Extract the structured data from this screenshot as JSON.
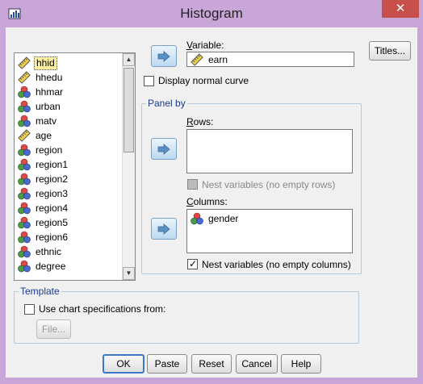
{
  "window": {
    "title": "Histogram",
    "close_glyph": "✕"
  },
  "variables": [
    {
      "name": "hhid",
      "icon": "ruler-scale-icon",
      "selected": true
    },
    {
      "name": "hhedu",
      "icon": "ruler-scale-icon"
    },
    {
      "name": "hhmar",
      "icon": "nominal-icon"
    },
    {
      "name": "urban",
      "icon": "nominal-icon"
    },
    {
      "name": "matv",
      "icon": "nominal-icon"
    },
    {
      "name": "age",
      "icon": "ruler-scale-icon"
    },
    {
      "name": "region",
      "icon": "nominal-icon"
    },
    {
      "name": "region1",
      "icon": "nominal-icon"
    },
    {
      "name": "region2",
      "icon": "nominal-icon"
    },
    {
      "name": "region3",
      "icon": "nominal-icon"
    },
    {
      "name": "region4",
      "icon": "nominal-icon"
    },
    {
      "name": "region5",
      "icon": "nominal-icon"
    },
    {
      "name": "region6",
      "icon": "nominal-icon"
    },
    {
      "name": "ethnic",
      "icon": "nominal-icon"
    },
    {
      "name": "degree",
      "icon": "nominal-icon"
    }
  ],
  "variable": {
    "label": "Variable:",
    "value": "earn"
  },
  "display_normal_curve": {
    "label": "Display normal curve",
    "checked": false
  },
  "panel_by": {
    "title": "Panel by",
    "rows_label": "Rows:",
    "rows_items": [],
    "nest_rows": {
      "label": "Nest variables (no empty rows)",
      "checked": false,
      "enabled": false
    },
    "columns_label": "Columns:",
    "columns_items": [
      "gender"
    ],
    "nest_columns": {
      "label": "Nest variables (no empty columns)",
      "checked": true,
      "enabled": true
    }
  },
  "template": {
    "title": "Template",
    "use_spec": {
      "label": "Use chart specifications from:",
      "checked": false
    },
    "file_button": "File..."
  },
  "buttons": {
    "titles": "Titles...",
    "ok": "OK",
    "paste": "Paste",
    "reset": "Reset",
    "cancel": "Cancel",
    "help": "Help"
  },
  "colors": {
    "title_bar": "#c8a6d8",
    "close": "#c7504b",
    "dialog_bg": "#f0f0f0",
    "group_title": "#1a3a8a"
  }
}
